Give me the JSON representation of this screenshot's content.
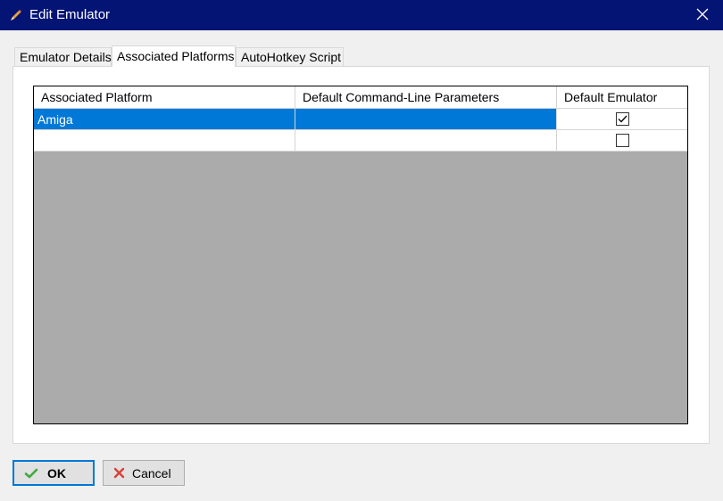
{
  "window": {
    "title": "Edit Emulator",
    "icon": "pencil-icon",
    "close_icon": "close-icon"
  },
  "tabs": [
    {
      "label": "Emulator Details",
      "active": false
    },
    {
      "label": "Associated Platforms",
      "active": true
    },
    {
      "label": "AutoHotkey Script",
      "active": false
    }
  ],
  "grid": {
    "columns": [
      "Associated Platform",
      "Default Command-Line Parameters",
      "Default Emulator"
    ],
    "rows": [
      {
        "platform": "Amiga",
        "params": "",
        "default": true,
        "selected": true
      },
      {
        "platform": "",
        "params": "",
        "default": false,
        "selected": false
      }
    ]
  },
  "buttons": {
    "ok": {
      "label": "OK",
      "icon": "checkmark-icon"
    },
    "cancel": {
      "label": "Cancel",
      "icon": "x-icon"
    }
  },
  "colors": {
    "titlebar": "#031475",
    "selection": "#0078d7",
    "grid_empty": "#ababab",
    "ok_icon": "#3fa93f",
    "cancel_icon": "#d9403a"
  }
}
